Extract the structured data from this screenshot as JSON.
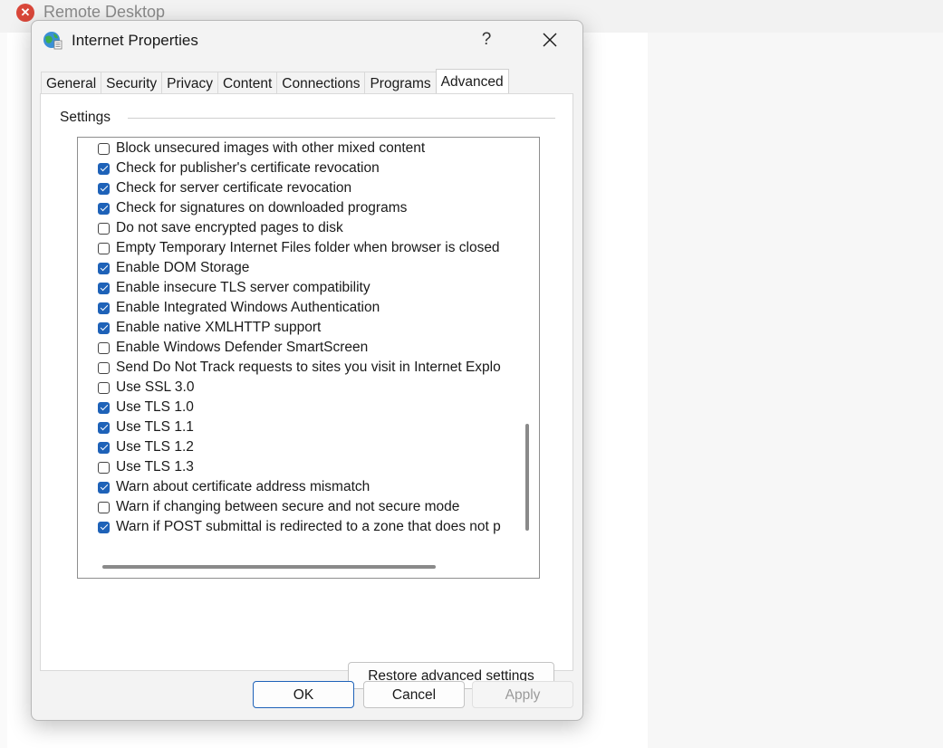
{
  "background_window": {
    "title": "Remote Desktop"
  },
  "dialog": {
    "title": "Internet Properties",
    "help_label": "?",
    "tabs": [
      {
        "label": "General"
      },
      {
        "label": "Security"
      },
      {
        "label": "Privacy"
      },
      {
        "label": "Content"
      },
      {
        "label": "Connections"
      },
      {
        "label": "Programs"
      },
      {
        "label": "Advanced"
      }
    ],
    "active_tab": "Advanced",
    "settings_label": "Settings",
    "settings_items": [
      {
        "label": "Block unsecured images with other mixed content",
        "checked": false
      },
      {
        "label": "Check for publisher's certificate revocation",
        "checked": true
      },
      {
        "label": "Check for server certificate revocation",
        "checked": true
      },
      {
        "label": "Check for signatures on downloaded programs",
        "checked": true
      },
      {
        "label": "Do not save encrypted pages to disk",
        "checked": false
      },
      {
        "label": "Empty Temporary Internet Files folder when browser is closed",
        "checked": false
      },
      {
        "label": "Enable DOM Storage",
        "checked": true
      },
      {
        "label": "Enable insecure TLS server compatibility",
        "checked": true
      },
      {
        "label": "Enable Integrated Windows Authentication",
        "checked": true
      },
      {
        "label": "Enable native XMLHTTP support",
        "checked": true
      },
      {
        "label": "Enable Windows Defender SmartScreen",
        "checked": false
      },
      {
        "label": "Send Do Not Track requests to sites you visit in Internet Explo",
        "checked": false
      },
      {
        "label": "Use SSL 3.0",
        "checked": false
      },
      {
        "label": "Use TLS 1.0",
        "checked": true
      },
      {
        "label": "Use TLS 1.1",
        "checked": true
      },
      {
        "label": "Use TLS 1.2",
        "checked": true
      },
      {
        "label": "Use TLS 1.3",
        "checked": false
      },
      {
        "label": "Warn about certificate address mismatch",
        "checked": true
      },
      {
        "label": "Warn if changing between secure and not secure mode",
        "checked": false
      },
      {
        "label": "Warn if POST submittal is redirected to a zone that does not p",
        "checked": true
      }
    ],
    "restore_button": "Restore advanced settings",
    "ok_button": "OK",
    "cancel_button": "Cancel",
    "apply_button": "Apply"
  },
  "colors": {
    "accent": "#1e62b8",
    "disabled_text": "#9a9a9a"
  }
}
